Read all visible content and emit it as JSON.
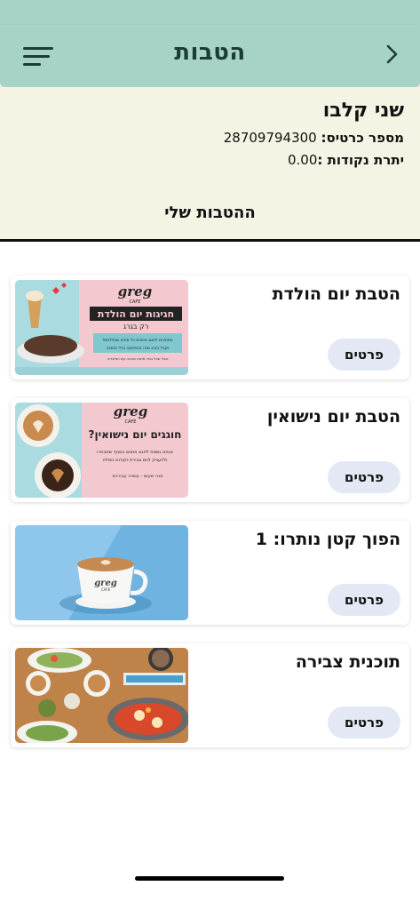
{
  "header": {
    "title": "הטבות"
  },
  "member": {
    "name": "שני קלבו",
    "card_label": "מספר כרטיס:",
    "card_number": "28709794300",
    "points_label": "יתרת נקודות :",
    "points_value": "0.00",
    "my_benefits_label": "ההטבות שלי"
  },
  "benefits": [
    {
      "title": "הטבת יום הולדת",
      "details_label": "פרטים",
      "image": {
        "brand": "greg",
        "brand_sub": "CAFE",
        "headline": "חגיגות יום הולדת",
        "subline": "רק בגרג",
        "body": "ומזמינים לחגוג איתכם כל חודש שנולדתם!",
        "body2": "וקבל בגרג מנה בהפתעה בכל הזמנה",
        "body3": "וכבל שכל בגדו מתנה גבוהה עם הפיצריה"
      }
    },
    {
      "title": "הטבת יום נישואין",
      "details_label": "פרטים",
      "image": {
        "brand": "greg",
        "brand_sub": "CAFE",
        "headline": "חוגגים יום נישואין?",
        "body": "אנחנו נשמח לחגוג אתכם בסניף שתבחרו",
        "body2": "ולהעניק לכם צבירת נקודות כפולה",
        "body3": "מנה שעשו - עשויה עבורכם"
      }
    },
    {
      "title": "הפוך קטן נותרו: 1",
      "details_label": "פרטים",
      "image": {
        "brand": "greg",
        "brand_sub": "CAFE"
      }
    },
    {
      "title": "תוכנית צבירה",
      "details_label": "פרטים",
      "image": {}
    }
  ],
  "colors": {
    "header_bg": "#a7d3c7",
    "header_text": "#1c3d33",
    "member_bg": "#f5f3e3",
    "details_button_bg": "#e3e8f4"
  },
  "icons": {
    "menu": "hamburger-menu-icon",
    "back": "chevron-right-icon"
  }
}
